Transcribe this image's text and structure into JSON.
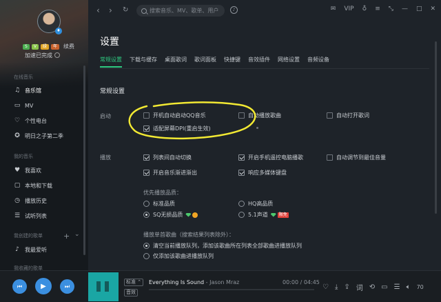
{
  "sidebar": {
    "badges": [
      "S",
      "V",
      "绿",
      "年"
    ],
    "renew": "续费",
    "quote": "加速已完成",
    "online_title": "在线音乐",
    "online_items": [
      {
        "label": "音乐馆",
        "icon": "music-hall-icon"
      },
      {
        "label": "MV",
        "icon": "mv-icon"
      },
      {
        "label": "个性电台",
        "icon": "radio-icon"
      },
      {
        "label": "明日之子第二季",
        "icon": "star-show-icon"
      }
    ],
    "my_title": "我的音乐",
    "my_items": [
      {
        "label": "我喜欢",
        "icon": "heart-icon"
      },
      {
        "label": "本地和下载",
        "icon": "local-download-icon"
      },
      {
        "label": "播放历史",
        "icon": "history-icon"
      },
      {
        "label": "试听列表",
        "icon": "playlist-icon"
      }
    ],
    "created_title": "我创建的歌单",
    "created_items": [
      {
        "label": "我最爱听",
        "icon": "favorite-playlist-icon"
      }
    ],
    "collected_title": "我收藏的歌单"
  },
  "topbar": {
    "search_placeholder": "搜索音乐、MV、歌单、用户",
    "vip": "VIP"
  },
  "settings": {
    "title": "设置",
    "tabs": [
      "常规设置",
      "下载与缓存",
      "桌面歌词",
      "歌词面板",
      "快捷键",
      "音效插件",
      "网络设置",
      "音频设备"
    ],
    "active_tab": "常规设置",
    "section_title": "常规设置",
    "startup_label": "启动",
    "startup_options": [
      {
        "label": "开机自动启动QQ音乐",
        "checked": false
      },
      {
        "label": "自动播放歌曲",
        "checked": false
      },
      {
        "label": "自动打开歌词",
        "checked": false
      },
      {
        "label": "适配屏幕DPI(重启生效)",
        "checked": true
      }
    ],
    "play_label": "播放",
    "play_options": [
      {
        "label": "列表间自动切换",
        "checked": true
      },
      {
        "label": "开启手机遥控电脑播歌",
        "checked": true
      },
      {
        "label": "自动调节到最佳音量",
        "checked": false
      },
      {
        "label": "开启音乐渐进渐出",
        "checked": true
      },
      {
        "label": "响应多媒体键盘",
        "checked": true
      }
    ],
    "quality_label": "优先播放品质：",
    "quality_options": [
      {
        "label": "标准品质",
        "selected": false
      },
      {
        "label": "HQ高品质",
        "selected": false
      },
      {
        "label": "SQ无损品质",
        "selected": true
      },
      {
        "label": "5.1声道",
        "selected": false
      }
    ],
    "quality_tag": "限免",
    "single_label": "播放单首歌曲（搜索结果列表除外）：",
    "single_options": [
      {
        "label": "清空当前播放队列，添加该歌曲所在列表全部歌曲进播放队列",
        "selected": true
      },
      {
        "label": "仅添加该歌曲进播放队列",
        "selected": false
      }
    ]
  },
  "player": {
    "quality_tag": "标准",
    "effect_tag": "音效",
    "title": "Everything Is Sound",
    "separator": " - ",
    "artist": "Jason Mraz",
    "time": "00:00 / 04:45",
    "volume": "70",
    "progress": 0,
    "accent": "#3b8fe0"
  },
  "colors": {
    "accent": "#2ecb81",
    "highlight": "#f2e933"
  }
}
